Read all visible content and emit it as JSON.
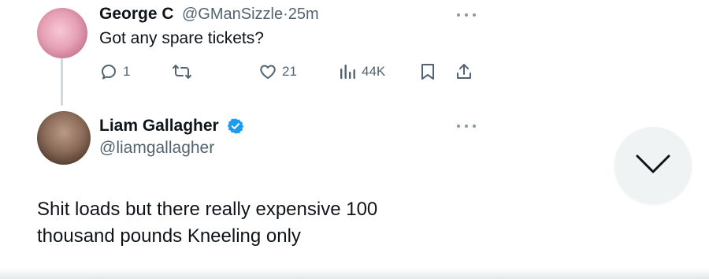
{
  "tweet1": {
    "author_name": "George C",
    "handle": "@GManSizzle",
    "separator": "·",
    "time": "25m",
    "text": "Got any spare tickets?",
    "actions": {
      "replies": "1",
      "retweets": "",
      "likes": "21",
      "views": "44K"
    }
  },
  "tweet2": {
    "author_name": "Liam Gallagher",
    "handle": "@liamgallagher",
    "text": "Shit loads but there really expensive 100 thousand pounds Kneeling only"
  },
  "icons": {
    "reply": "reply-icon",
    "retweet": "retweet-icon",
    "like": "heart-icon",
    "views": "views-icon",
    "bookmark": "bookmark-icon",
    "share": "share-icon",
    "more": "more-icon",
    "verified": "verified-badge-icon",
    "scroll": "chevron-down-icon"
  },
  "colors": {
    "text": "#0f1419",
    "secondary": "#536471",
    "verified": "#1d9bf0",
    "scroll_button_bg": "#eff3f4"
  }
}
